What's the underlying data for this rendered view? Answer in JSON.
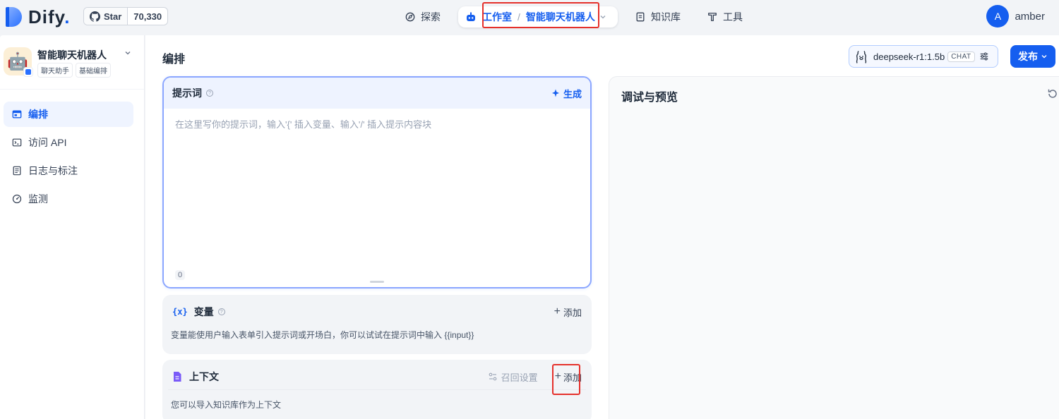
{
  "brand": {
    "name": "Dify",
    "dot": "."
  },
  "github": {
    "star_label": "Star",
    "star_count": "70,330"
  },
  "nav": {
    "explore": "探索",
    "studio": "工作室",
    "separator": "/",
    "current_app": "智能聊天机器人",
    "knowledge": "知识库",
    "tools": "工具"
  },
  "user": {
    "initial": "A",
    "name": "amber"
  },
  "app": {
    "name": "智能聊天机器人",
    "tags": [
      "聊天助手",
      "基础编排"
    ],
    "icon": "robot-icon"
  },
  "sidebar": {
    "items": [
      {
        "label": "编排",
        "icon": "layout-icon",
        "active": true
      },
      {
        "label": "访问 API",
        "icon": "terminal-icon",
        "active": false
      },
      {
        "label": "日志与标注",
        "icon": "file-list-icon",
        "active": false
      },
      {
        "label": "监测",
        "icon": "dashboard-icon",
        "active": false
      }
    ]
  },
  "header": {
    "title": "编排",
    "model_name": "deepseek-r1:1.5b",
    "model_mode": "CHAT",
    "publish_label": "发布"
  },
  "prompt": {
    "title": "提示词",
    "generate_label": "生成",
    "placeholder": "在这里写你的提示词，输入'{' 插入变量、输入'/' 插入提示内容块",
    "char_count": "0"
  },
  "variables": {
    "icon_text": "{x}",
    "title": "变量",
    "add_label": "添加",
    "description": "变量能使用户输入表单引入提示词或开场白，你可以试试在提示词中输入 {{input}}"
  },
  "context": {
    "title": "上下文",
    "recall_label": "召回设置",
    "add_label": "添加",
    "description": "您可以导入知识库作为上下文"
  },
  "debug": {
    "title": "调试与预览"
  },
  "colors": {
    "primary": "#155eef",
    "highlight_box": "#e5302b",
    "panel_bg": "#f2f4f7"
  }
}
